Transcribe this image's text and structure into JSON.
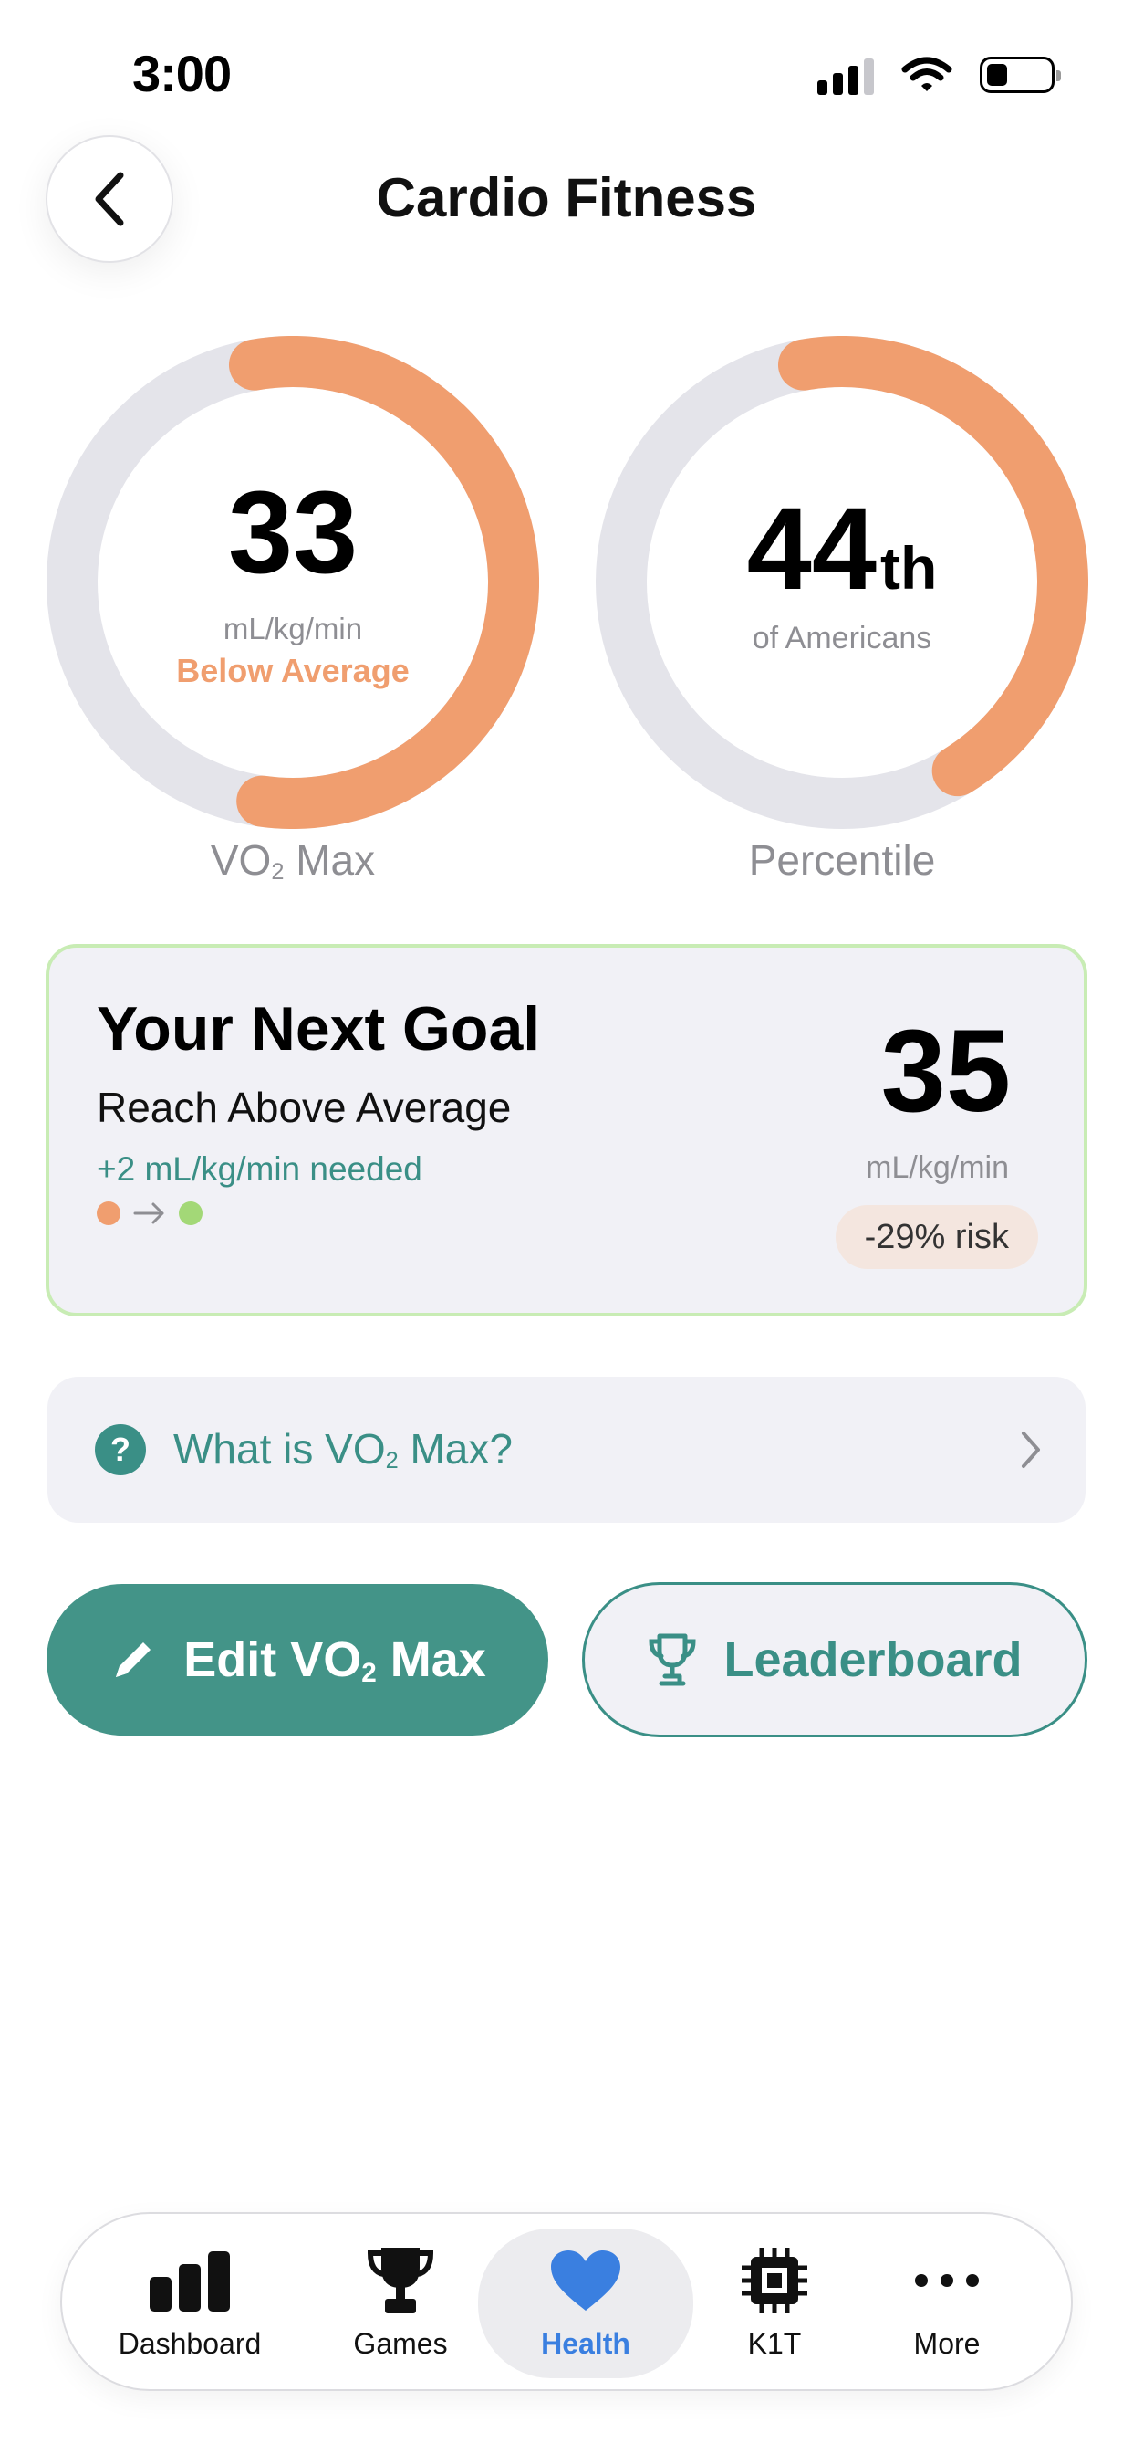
{
  "status_bar": {
    "time": "3:00"
  },
  "header": {
    "title": "Cardio Fitness"
  },
  "vo2": {
    "value": "33",
    "unit": "mL/kg/min",
    "rating": "Below Average",
    "caption_main": "VO",
    "caption_sub": "2",
    "caption_tail": " Max",
    "ring_fill_fraction": 0.55
  },
  "percentile": {
    "value": "44",
    "suffix": "th",
    "subtitle": "of Americans",
    "caption": "Percentile",
    "ring_fill_fraction": 0.44
  },
  "goal": {
    "title": "Your Next Goal",
    "subtitle": "Reach Above Average",
    "needed": "+2 mL/kg/min needed",
    "value": "35",
    "unit": "mL/kg/min",
    "risk": "-29% risk"
  },
  "info": {
    "label_main": "What is VO",
    "label_sub": "2",
    "label_tail": " Max?"
  },
  "actions": {
    "edit_main": "Edit VO",
    "edit_sub": "2",
    "edit_tail": " Max",
    "leaderboard": "Leaderboard"
  },
  "tabs": [
    {
      "label": "Dashboard",
      "icon": "bar-chart-icon"
    },
    {
      "label": "Games",
      "icon": "trophy-icon"
    },
    {
      "label": "Health",
      "icon": "heart-icon",
      "active": true
    },
    {
      "label": "K1T",
      "icon": "chip-icon"
    },
    {
      "label": "More",
      "icon": "more-icon"
    }
  ],
  "colors": {
    "accent_teal": "#439488",
    "ring_orange": "#f09e6f",
    "ring_track": "#e4e4ea",
    "goal_border": "#c8ecb4",
    "active_tab_blue": "#3a7fe0"
  }
}
